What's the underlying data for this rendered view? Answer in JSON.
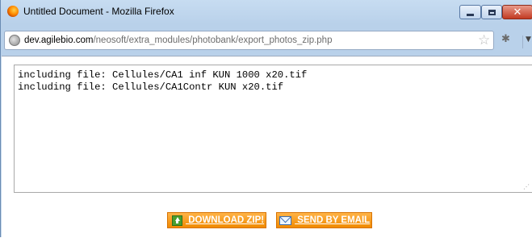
{
  "window": {
    "title": "Untitled Document - Mozilla Firefox",
    "close_glyph": "✕"
  },
  "toolbar": {
    "url_host": "dev.agilebio.com",
    "url_path": "/neosoft/extra_modules/photobank/export_photos_zip.php",
    "star_glyph": "☆",
    "addon_glyph": "✱",
    "menu_glyph": "▼"
  },
  "log": {
    "text": "including file: Cellules/CA1 inf KUN 1000 x20.tif\nincluding file: Cellules/CA1Contr KUN x20.tif"
  },
  "actions": {
    "download_label": " DOWNLOAD ZIP!",
    "email_label": " SEND BY EMAIL"
  },
  "colors": {
    "button_orange": "#f5a021",
    "frame_blue": "#b9d1ea"
  },
  "icons": [
    "firefox-icon",
    "minimize-icon",
    "maximize-icon",
    "close-icon",
    "site-identity-icon",
    "bookmark-star-icon",
    "addon-icon",
    "menu-arrow-icon",
    "download-icon",
    "email-icon",
    "resize-grip-icon"
  ]
}
